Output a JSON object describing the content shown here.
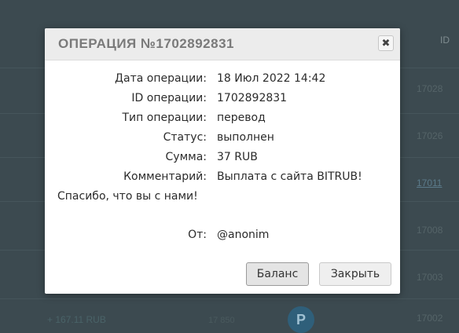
{
  "background": {
    "id_column_header": "ID",
    "right_ids": [
      "17028",
      "17026",
      "17011",
      "17008",
      "17003",
      "17002"
    ],
    "bottom_amount": "+ 167.11 RUB",
    "bottom_small": "17 850",
    "bottom_icon_letter": "P"
  },
  "modal": {
    "title": "ОПЕРАЦИЯ №1702892831",
    "close_glyph": "✖",
    "fields": [
      {
        "label": "Дата операции:",
        "value": "18 Июл 2022 14:42"
      },
      {
        "label": "ID операции:",
        "value": "1702892831"
      },
      {
        "label": "Тип операции:",
        "value": "перевод"
      },
      {
        "label": "Статус:",
        "value": "выполнен"
      },
      {
        "label": "Сумма:",
        "value": "37 RUB"
      },
      {
        "label": "Комментарий:",
        "value": "Выплата с сайта BITRUB!"
      }
    ],
    "message": "Спасибо, что вы с нами!",
    "from": {
      "label": "От:",
      "value": "@anonim"
    },
    "buttons": {
      "balance": "Баланс",
      "close": "Закрыть"
    }
  }
}
